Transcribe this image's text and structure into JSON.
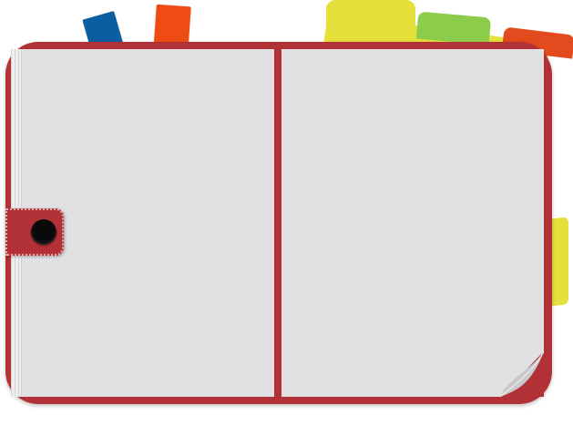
{
  "colors": {
    "cover": "#b23137",
    "page": "#e1e0e2",
    "page_edge": "#eeeeee",
    "tab_blue": "#0b5ea1",
    "tab_orange": "#ef4c13",
    "folder_yellow": "#e6e03d",
    "folder_yellow_dark": "#d8d134",
    "tab_green": "#8ccc4b",
    "tab_red": "#e34a1d",
    "snap": "#0a0a0a",
    "curl": "#c9c9cb"
  },
  "icons": {
    "blue_bookmark": "bookmark-tab-icon",
    "orange_bookmark": "bookmark-tab-icon",
    "strap_button": "snap-button-icon",
    "page_curl": "page-curl-icon"
  }
}
